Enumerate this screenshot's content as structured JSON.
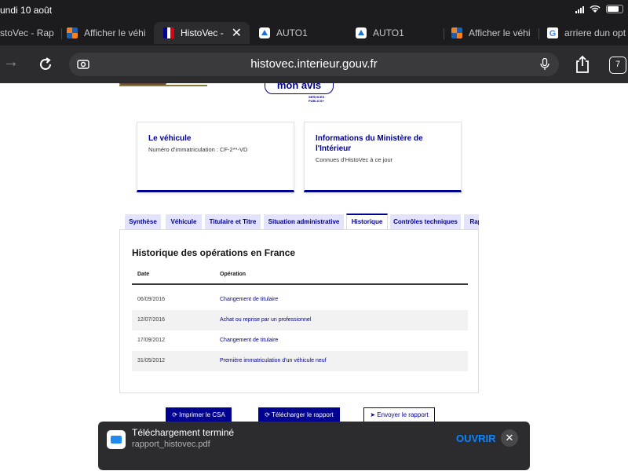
{
  "status": {
    "time": "undi 10 août",
    "battery_percent": 75
  },
  "browser": {
    "tabs": [
      {
        "label": "stoVec - Rap",
        "favicon": "orange-checker-icon"
      },
      {
        "label": "Afficher le véhi",
        "favicon": "orange-checker-icon"
      },
      {
        "label": "HistoVec -",
        "favicon": "marianne-icon",
        "active": true
      },
      {
        "label": "AUTO1",
        "favicon": "auto1-icon"
      },
      {
        "label": "AUTO1",
        "favicon": "auto1-icon"
      },
      {
        "label": "Afficher le véhi",
        "favicon": "orange-checker-icon"
      },
      {
        "label": "arriere dun opt",
        "favicon": "google-icon"
      }
    ],
    "url": "histovec.interieur.gouv.fr",
    "tab_count": "7"
  },
  "page": {
    "banner": {
      "line1": "mon avis",
      "line2": "SERVICES",
      "line3": "PUBLICS+"
    },
    "cards": [
      {
        "title": "Le véhicule",
        "text": "Numéro d'immatriculation : CF-2**-VD"
      },
      {
        "title": "Informations du Ministère de l'Intérieur",
        "text": "Connues d'HistoVec à ce jour"
      }
    ],
    "tabs": [
      "Synthèse",
      "Véhicule",
      "Titulaire et Titre",
      "Situation administrative",
      "Historique",
      "Contrôles techniques",
      "Rap"
    ],
    "active_tab": "Historique",
    "history": {
      "title": "Historique des opérations en France",
      "headers": {
        "date": "Date",
        "operation": "Opération"
      },
      "rows": [
        {
          "date": "06/09/2016",
          "operation": "Changement de titulaire"
        },
        {
          "date": "12/07/2016",
          "operation": "Achat ou reprise par un professionnel"
        },
        {
          "date": "17/09/2012",
          "operation": "Changement de titulaire"
        },
        {
          "date": "31/05/2012",
          "operation": "Première immatriculation d'un véhicule neuf"
        }
      ]
    },
    "buttons": {
      "print": "Imprimer le CSA",
      "download": "Télécharger le rapport",
      "send": "Envoyer le rapport"
    }
  },
  "download": {
    "title": "Téléchargement terminé",
    "file": "rapport_histovec.pdf",
    "open": "OUVRIR"
  },
  "colors": {
    "primary": "#000091",
    "tab_bg": "#e3e3fd",
    "ios_blue": "#0a84ff"
  }
}
